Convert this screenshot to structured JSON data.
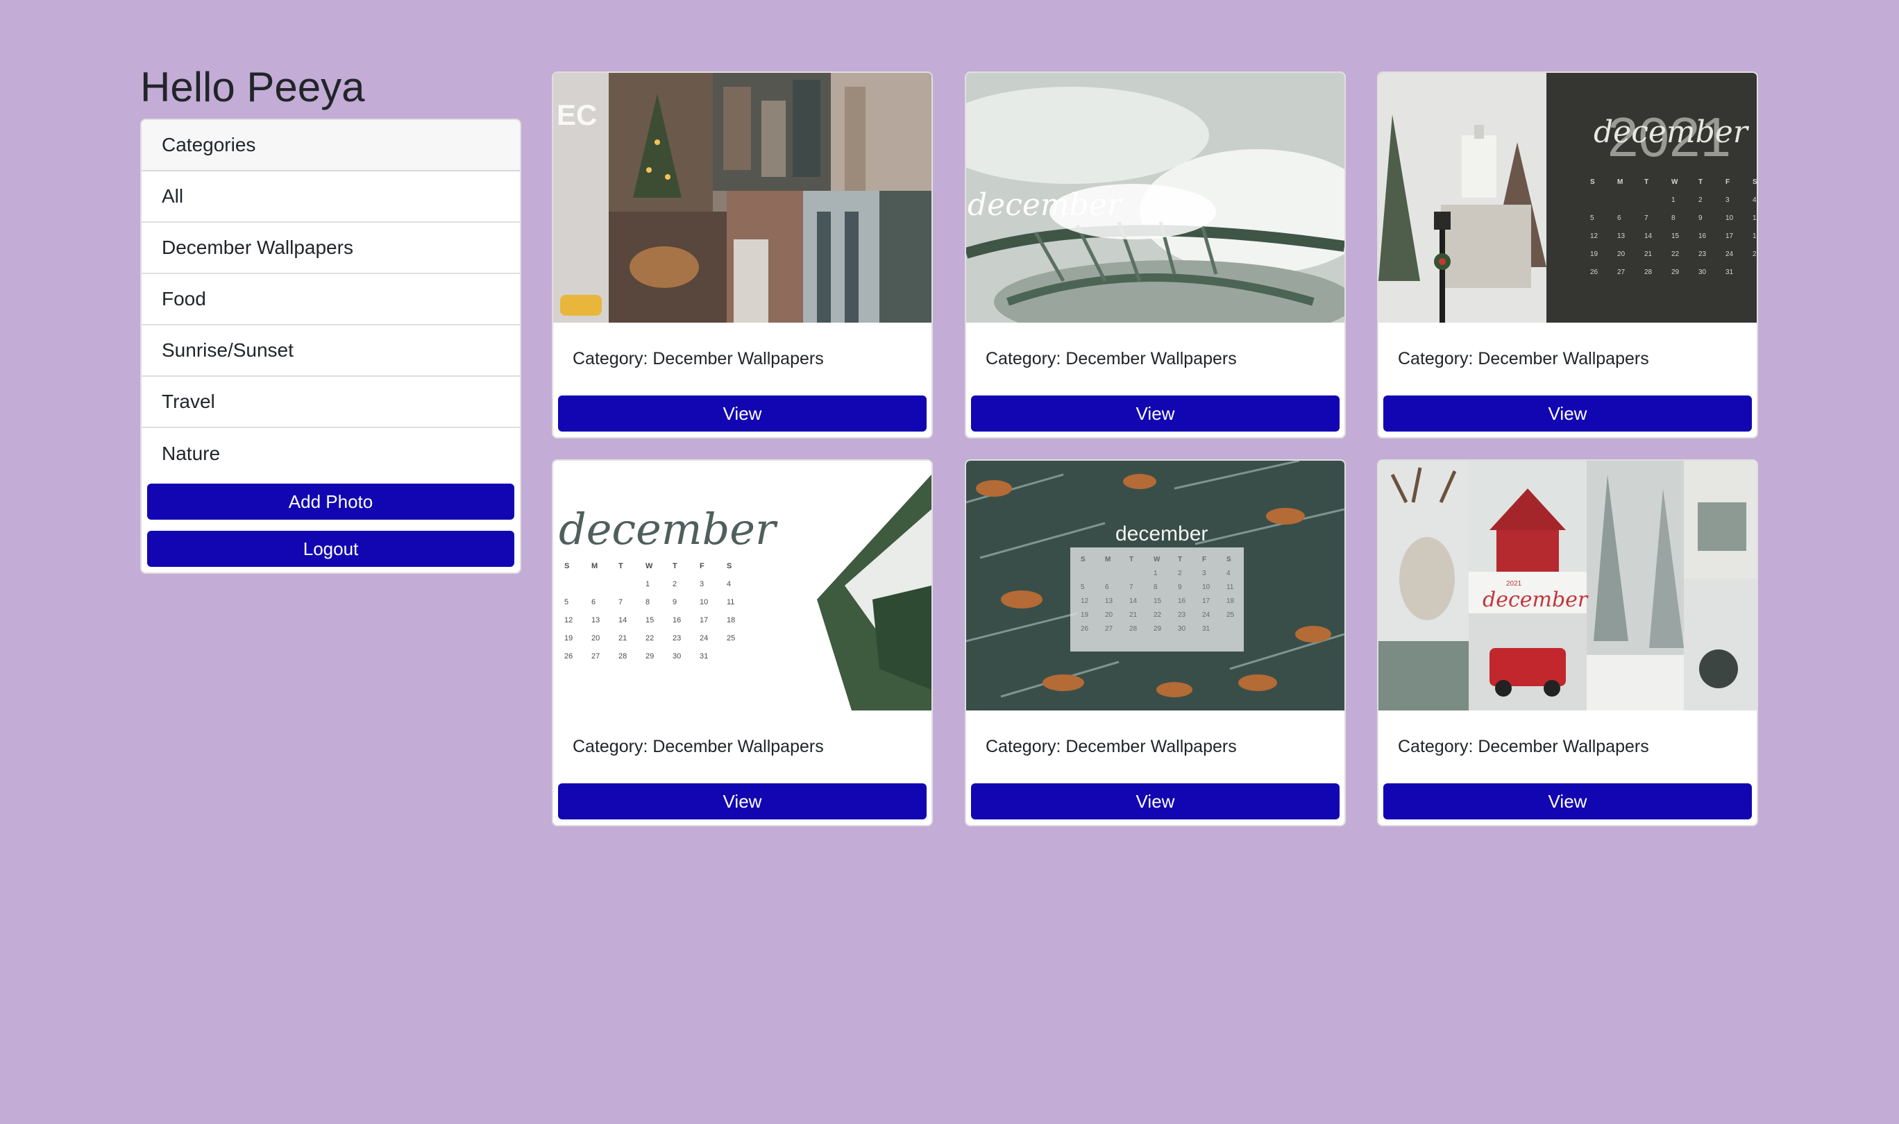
{
  "greeting": "Hello Peeya",
  "sidebar": {
    "header": "Categories",
    "items": [
      {
        "label": "All"
      },
      {
        "label": "December Wallpapers"
      },
      {
        "label": "Food"
      },
      {
        "label": "Sunrise/Sunset"
      },
      {
        "label": "Travel"
      },
      {
        "label": "Nature"
      }
    ],
    "add_photo_label": "Add Photo",
    "logout_label": "Logout"
  },
  "cards": [
    {
      "caption": "Category: December Wallpapers",
      "view_label": "View",
      "image": "nyc-winter-collage"
    },
    {
      "caption": "Category: December Wallpapers",
      "view_label": "View",
      "image": "snowy-pine-december"
    },
    {
      "caption": "Category: December Wallpapers",
      "view_label": "View",
      "image": "december-2021-calendar-church"
    },
    {
      "caption": "Category: December Wallpapers",
      "view_label": "View",
      "image": "december-calendar-white-pine"
    },
    {
      "caption": "Category: December Wallpapers",
      "view_label": "View",
      "image": "pine-leaves-december-calendar"
    },
    {
      "caption": "Category: December Wallpapers",
      "view_label": "View",
      "image": "reindeer-red-truck-collage"
    }
  ],
  "images": {
    "card1": {
      "overlay_text": "EC"
    },
    "card2": {
      "script_text": "december"
    },
    "card3": {
      "year": "2021",
      "script_text": "december"
    },
    "card4": {
      "script_text": "december"
    },
    "card5": {
      "script_text": "december"
    },
    "card6": {
      "year": "2021",
      "script_text": "december"
    }
  },
  "calendar": {
    "weekdays": [
      "S",
      "M",
      "T",
      "W",
      "T",
      "F",
      "S"
    ],
    "weeks": [
      [
        "",
        "",
        "",
        "1",
        "2",
        "3",
        "4"
      ],
      [
        "5",
        "6",
        "7",
        "8",
        "9",
        "10",
        "11"
      ],
      [
        "12",
        "13",
        "14",
        "15",
        "16",
        "17",
        "18"
      ],
      [
        "19",
        "20",
        "21",
        "22",
        "23",
        "24",
        "25"
      ],
      [
        "26",
        "27",
        "28",
        "29",
        "30",
        "31",
        ""
      ]
    ]
  },
  "colors": {
    "page_background": "#c3acd5",
    "button": "#1106b1",
    "button_text": "#ffffff"
  }
}
